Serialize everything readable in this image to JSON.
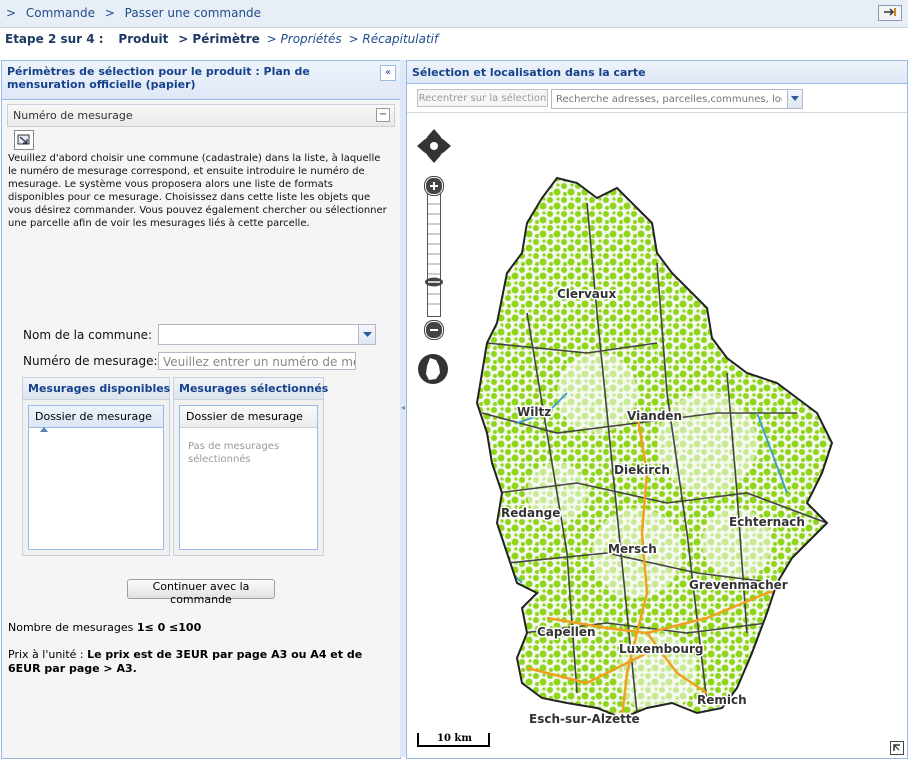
{
  "breadcrumb": {
    "prefix": ">",
    "items": [
      "Commande",
      "Passer une commande"
    ],
    "separator": ">"
  },
  "steps": {
    "label": "Etape 2 sur 4 :",
    "items": [
      {
        "text": "Produit",
        "state": "done"
      },
      {
        "text": "> Périmètre",
        "state": "current"
      },
      {
        "text": "> Propriétés",
        "state": "todo"
      },
      {
        "text": "> Récapitulatif",
        "state": "todo"
      }
    ]
  },
  "left_panel": {
    "title": "Périmètres de sélection pour le produit : Plan de mensuration officielle (papier)",
    "collapse_symbol": "«",
    "section_title": "Numéro de mesurage",
    "section_toggle": "−",
    "intro": "Veuillez d'abord choisir une commune (cadastrale) dans la liste, à laquelle le numéro de mesurage correspond, et ensuite introduire le numéro de mesurage. Le système vous proposera alors une liste de formats disponibles pour ce mesurage. Choisissez dans cette liste les objets que vous désirez commander. Vous pouvez également chercher ou sélectionner une parcelle afin de voir les mesurages liés à cette parcelle.",
    "commune_label": "Nom de la commune:",
    "commune_value": "",
    "number_label": "Numéro de mesurage:",
    "number_placeholder": "Veuillez entrer un numéro de mesurage",
    "available": {
      "title": "Mesurages disponibles",
      "column": "Dossier de mesurage",
      "sort": "ascending"
    },
    "selected": {
      "title": "Mesurages sélectionnés",
      "column": "Dossier de mesurage",
      "empty_text": "Pas de mesurages sélectionnés"
    },
    "continue_label": "Continuer avec la commande",
    "count_prefix": "Nombre de mesurages ",
    "count_value": "1≤ 0 ≤100",
    "price_prefix": "Prix à l'unité : ",
    "price_value": "Le prix est de 3EUR par page A3 ou A4 et de 6EUR par page > A3."
  },
  "map_panel": {
    "title": "Sélection et localisation dans la carte",
    "recenter_label": "Recentrer sur la sélection",
    "search_placeholder": "Recherche adresses, parcelles,communes, localités",
    "search_value": "",
    "towns": [
      "Clervaux",
      "Wiltz",
      "Vianden",
      "Diekirch",
      "Redange",
      "Echternach",
      "Mersch",
      "Grevenmacher",
      "Capellen",
      "Luxembourg",
      "Esch-sur-Alzette",
      "Remich"
    ],
    "scale_label": "10 km",
    "colors": {
      "forest": "#8fd61a",
      "border": "#333333",
      "roads": "#f0a020",
      "water": "#3a9bd6"
    }
  }
}
